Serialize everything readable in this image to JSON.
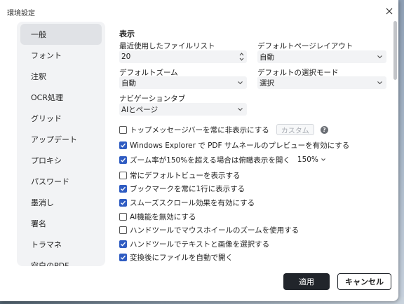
{
  "window": {
    "title": "環境設定"
  },
  "sidebar": {
    "items": [
      {
        "label": "一般",
        "active": true
      },
      {
        "label": "フォント",
        "active": false
      },
      {
        "label": "注釈",
        "active": false
      },
      {
        "label": "OCR処理",
        "active": false
      },
      {
        "label": "グリッド",
        "active": false
      },
      {
        "label": "アップデート",
        "active": false
      },
      {
        "label": "プロキシ",
        "active": false
      },
      {
        "label": "パスワード",
        "active": false
      },
      {
        "label": "墨消し",
        "active": false
      },
      {
        "label": "署名",
        "active": false
      },
      {
        "label": "トラマネ",
        "active": false
      },
      {
        "label": "空白のPDF",
        "active": false
      }
    ]
  },
  "main": {
    "section_title": "表示",
    "recent_files": {
      "label": "最近使用したファイルリスト",
      "value": "20"
    },
    "default_page_layout": {
      "label": "デフォルトページレイアウト",
      "value": "自動"
    },
    "default_zoom": {
      "label": "デフォルトズーム",
      "value": "自動"
    },
    "default_select_mode": {
      "label": "デフォルトの選択モード",
      "value": "選択"
    },
    "navigation_tab": {
      "label": "ナビゲーションタブ",
      "value": "AIとページ"
    },
    "checkboxes": [
      {
        "label": "トップメッセージバーを常に非表示にする",
        "checked": false
      },
      {
        "label": "Windows Explorer で PDF サムネールのプレビューを有効にする",
        "checked": true
      },
      {
        "label": "ズーム率が150%を超える場合は俯瞰表示を開く",
        "checked": true
      },
      {
        "label": "常にデフォルトビューを表示する",
        "checked": false
      },
      {
        "label": "ブックマークを常に1行に表示する",
        "checked": true
      },
      {
        "label": "スムーズスクロール効果を有効にする",
        "checked": true
      },
      {
        "label": "AI機能を無効にする",
        "checked": false
      },
      {
        "label": "ハンドツールでマウスホイールのズームを使用する",
        "checked": false
      },
      {
        "label": "ハンドツールでテキストと画像を選択する",
        "checked": true
      },
      {
        "label": "変換後にファイルを自動で開く",
        "checked": true
      }
    ],
    "custom_button": "カスタム",
    "zoom_threshold": "150%"
  },
  "footer": {
    "apply": "適用",
    "cancel": "キャンセル"
  },
  "colors": {
    "accent": "#2f5cc2",
    "primary_button": "#21252b",
    "sidebar_bg": "#f2f3f5"
  },
  "icons": [
    "close-icon",
    "chevron-down-icon",
    "spinner-icon",
    "check-icon",
    "help-icon"
  ]
}
